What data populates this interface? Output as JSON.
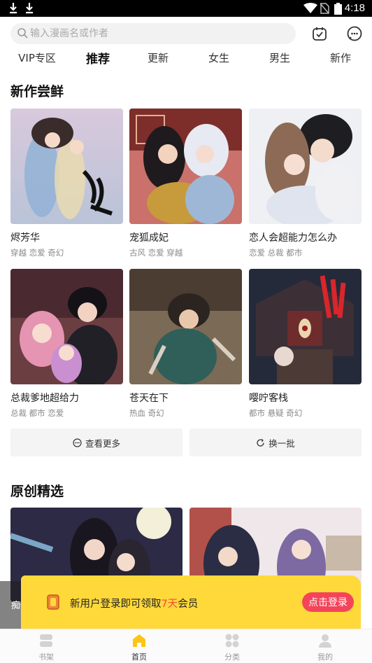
{
  "status_bar": {
    "time": "4:18"
  },
  "search": {
    "placeholder": "输入漫画名或作者"
  },
  "tabs": [
    {
      "label": "VIP专区"
    },
    {
      "label": "推荐",
      "active": true
    },
    {
      "label": "更新"
    },
    {
      "label": "女生"
    },
    {
      "label": "男生"
    },
    {
      "label": "新作"
    }
  ],
  "new_section": {
    "title": "新作尝鲜",
    "comics": [
      {
        "title": "烬芳华",
        "tags": "穿越 恋爱 奇幻"
      },
      {
        "title": "宠狐成妃",
        "tags": "古风 恋爱 穿越"
      },
      {
        "title": "恋人会超能力怎么办",
        "tags": "恋爱 总裁 都市"
      },
      {
        "title": "总裁爹地超给力",
        "tags": "总裁 都市 恋爱"
      },
      {
        "title": "苍天在下",
        "tags": "热血 奇幻"
      },
      {
        "title": "嘤咛客栈",
        "tags": "都市 悬疑 奇幻"
      }
    ],
    "more_label": "查看更多",
    "refresh_label": "换一批"
  },
  "original_section": {
    "title": "原创精选",
    "peek_title": "痴傻毒"
  },
  "login_banner": {
    "text_before": "新用户登录即可领取",
    "highlight": "7天",
    "text_after": "会员",
    "button": "点击登录"
  },
  "bottom_nav": [
    {
      "label": "书架",
      "icon": "bookshelf-icon"
    },
    {
      "label": "首页",
      "icon": "home-icon",
      "active": true
    },
    {
      "label": "分类",
      "icon": "category-icon"
    },
    {
      "label": "我的",
      "icon": "profile-icon"
    }
  ],
  "colors": {
    "accent": "#ffd93a",
    "login_button": "#f4445a",
    "highlight": "#f04b3a"
  }
}
